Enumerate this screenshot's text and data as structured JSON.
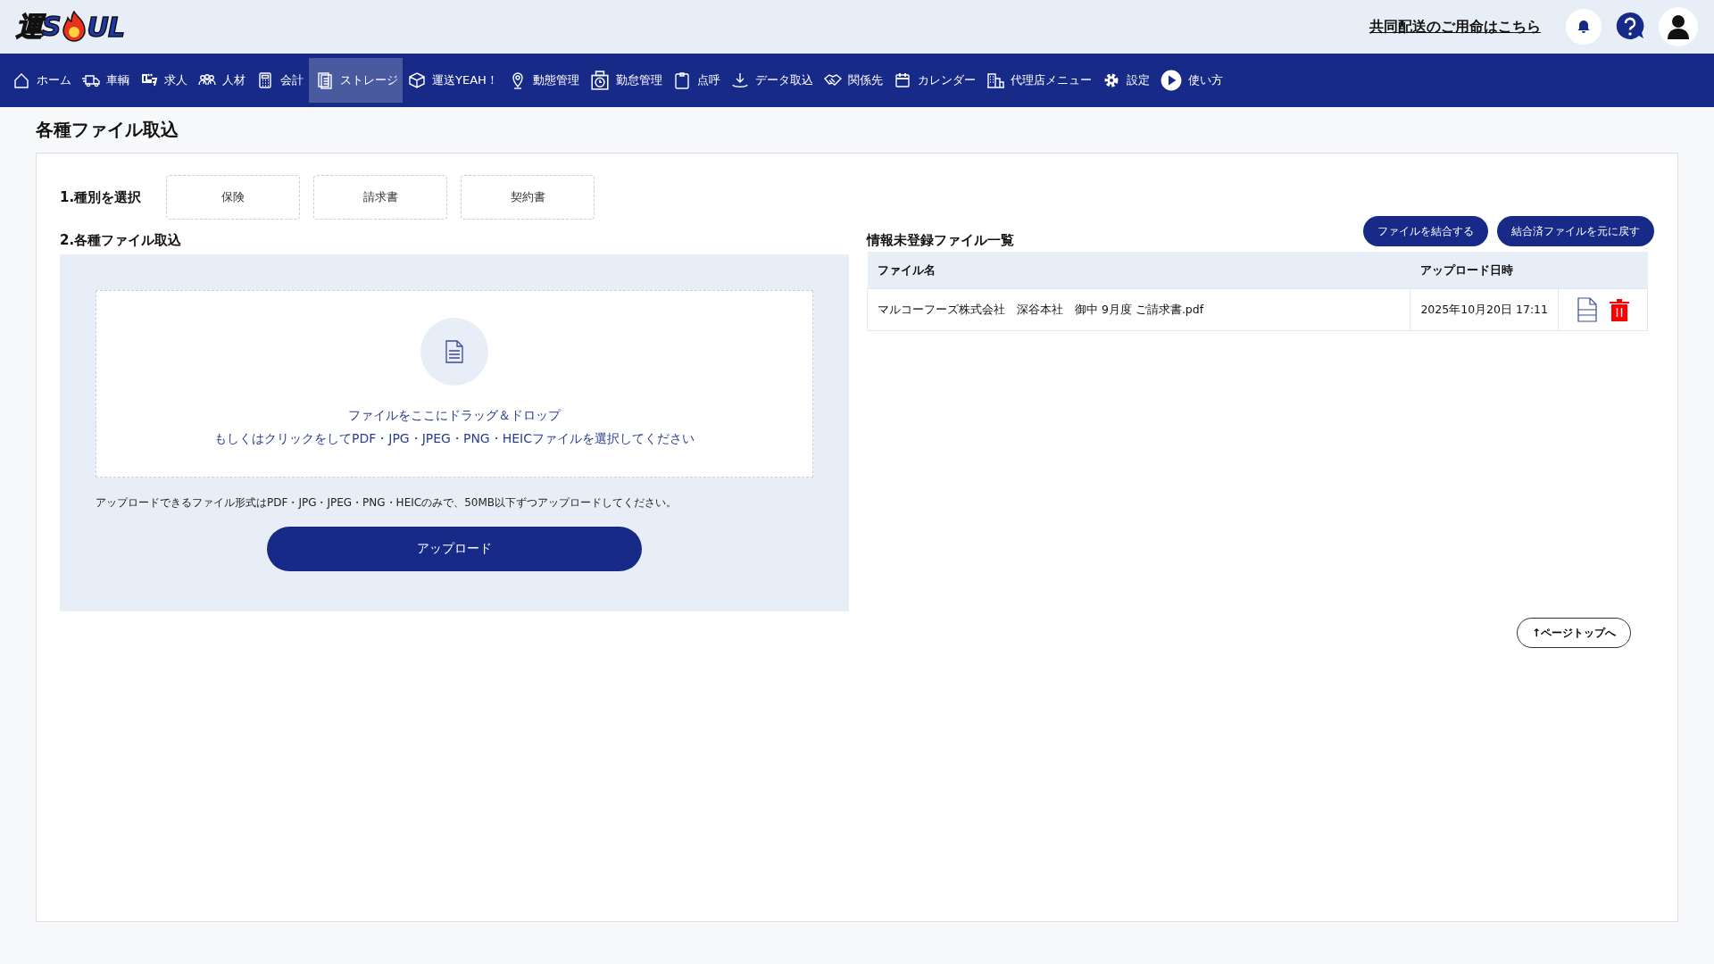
{
  "header": {
    "logo": {
      "before": "運S",
      "after": "UL"
    },
    "link": "共同配送のご用命はこちら"
  },
  "nav": [
    {
      "label": "ホーム",
      "selected": false
    },
    {
      "label": "車輌",
      "selected": false
    },
    {
      "label": "求人",
      "selected": false
    },
    {
      "label": "人材",
      "selected": false
    },
    {
      "label": "会計",
      "selected": false
    },
    {
      "label": "ストレージ",
      "selected": true
    },
    {
      "label": "運送YEAH！",
      "selected": false
    },
    {
      "label": "動態管理",
      "selected": false
    },
    {
      "label": "勤怠管理",
      "selected": false
    },
    {
      "label": "点呼",
      "selected": false
    },
    {
      "label": "データ取込",
      "selected": false
    },
    {
      "label": "関係先",
      "selected": false
    },
    {
      "label": "カレンダー",
      "selected": false
    },
    {
      "label": "代理店メニュー",
      "selected": false
    },
    {
      "label": "設定",
      "selected": false
    },
    {
      "label": "使い方",
      "selected": false
    }
  ],
  "page_title": "各種ファイル取込",
  "step1": {
    "label": "1.種別を選択",
    "types": [
      {
        "label": "保険",
        "selected": false
      },
      {
        "label": "請求書",
        "selected": false
      },
      {
        "label": "契約書",
        "selected": false
      }
    ]
  },
  "step2": {
    "label": "2.各種ファイル取込",
    "drop_text": "ファイルをここにドラッグ＆ドロップ",
    "drop_hint": "もしくはクリックをしてPDF・JPG・JPEG・PNG・HEICファイルを選択してください",
    "note": "アップロードできるファイル形式はPDF・JPG・JPEG・PNG・HEICのみで、50MB以下ずつアップロードしてください。",
    "upload_button": "アップロード"
  },
  "file_list": {
    "title": "情報未登録ファイル一覧",
    "buttons": [
      "ファイルを結合する",
      "結合済ファイルを元に戻す"
    ],
    "columns": [
      "ファイル名",
      "アップロード日時"
    ],
    "rows": [
      {
        "name": "マルコーフーズ株式会社　深谷本社　御中 9月度 ご請求書.pdf",
        "uploaded": "2025年10月20日 17:11"
      }
    ]
  },
  "page_top": "↑ページトップへ"
}
